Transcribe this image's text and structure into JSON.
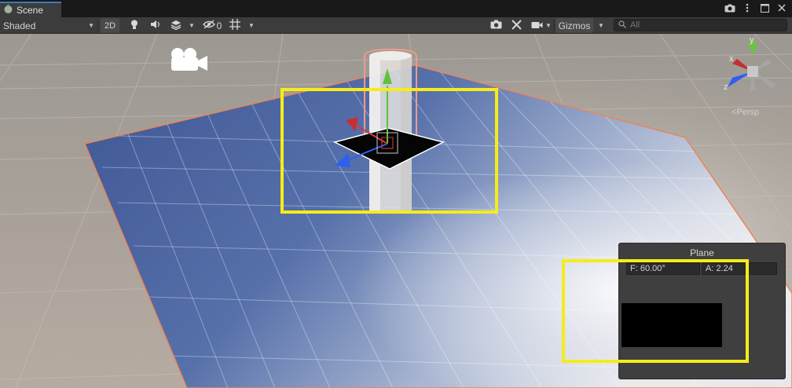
{
  "tab": {
    "label": "Scene"
  },
  "toolbar": {
    "draw_mode": "Shaded",
    "mode_2d": "2D",
    "hidden_count": "0",
    "gizmos_label": "Gizmos"
  },
  "search": {
    "placeholder": "All"
  },
  "viewport": {
    "persp_label": "Persp",
    "axis_x": "x",
    "axis_y": "y",
    "axis_z": "z"
  },
  "camera_preview": {
    "title": "Plane",
    "fov": "F: 60.00°",
    "aspect": "A: 2.24"
  },
  "colors": {
    "highlight": "#f6ec1a",
    "plane_blue": "#4a64a6",
    "selection_outline": "#e8855a"
  }
}
